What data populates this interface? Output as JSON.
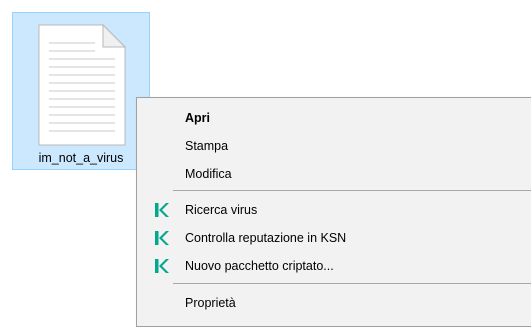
{
  "desktop": {
    "file": {
      "name": "im_not_a_virus",
      "icon": "text-file-icon",
      "selected": true
    }
  },
  "context_menu": {
    "groups": [
      [
        {
          "label": "Apri",
          "bold": true
        },
        {
          "label": "Stampa"
        },
        {
          "label": "Modifica"
        }
      ],
      [
        {
          "label": "Ricerca virus",
          "icon": "kaspersky-k-icon"
        },
        {
          "label": "Controlla reputazione in KSN",
          "icon": "kaspersky-k-icon"
        },
        {
          "label": "Nuovo pacchetto criptato...",
          "icon": "kaspersky-k-icon"
        }
      ],
      [
        {
          "label": "Proprietà"
        }
      ]
    ],
    "icon_color": "#00a88e"
  }
}
